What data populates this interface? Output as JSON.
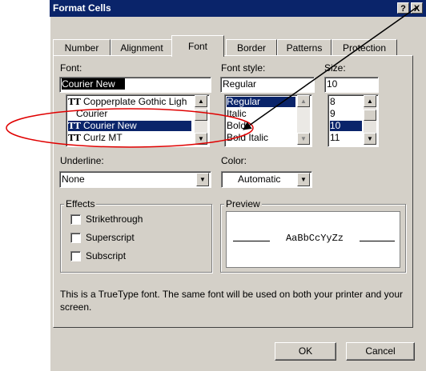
{
  "window": {
    "title": "Format Cells",
    "help_glyph": "?",
    "close_glyph": "X"
  },
  "tabs": [
    {
      "label": "Number"
    },
    {
      "label": "Alignment"
    },
    {
      "label": "Font"
    },
    {
      "label": "Border"
    },
    {
      "label": "Patterns"
    },
    {
      "label": "Protection"
    }
  ],
  "font": {
    "label": "Font:",
    "value": "Courier New",
    "items": [
      {
        "icon": "TT",
        "label": "Copperplate Gothic Ligh"
      },
      {
        "icon": "",
        "label": "Courier"
      },
      {
        "icon": "TT",
        "label": "Courier New",
        "selected": true
      },
      {
        "icon": "TT",
        "label": "Curlz MT"
      }
    ]
  },
  "font_style": {
    "label": "Font style:",
    "value": "Regular",
    "items": [
      {
        "label": "Regular",
        "selected": true
      },
      {
        "label": "Italic"
      },
      {
        "label": "Bold"
      },
      {
        "label": "Bold Italic"
      }
    ]
  },
  "size": {
    "label": "Size:",
    "value": "10",
    "items": [
      {
        "label": "8"
      },
      {
        "label": "9"
      },
      {
        "label": "10",
        "selected": true
      },
      {
        "label": "11"
      }
    ]
  },
  "underline": {
    "label": "Underline:",
    "value": "None"
  },
  "color": {
    "label": "Color:",
    "value": "Automatic"
  },
  "effects": {
    "label": "Effects",
    "strikethrough": "Strikethrough",
    "superscript": "Superscript",
    "subscript": "Subscript"
  },
  "preview": {
    "label": "Preview",
    "sample": "AaBbCcYyZz"
  },
  "info_text": "This is a TrueType font.  The same font will be used on both your printer and your screen.",
  "buttons": {
    "ok": "OK",
    "cancel": "Cancel"
  },
  "annotation": {
    "ellipse_color": "#e00000",
    "arrow_color": "#000000"
  }
}
